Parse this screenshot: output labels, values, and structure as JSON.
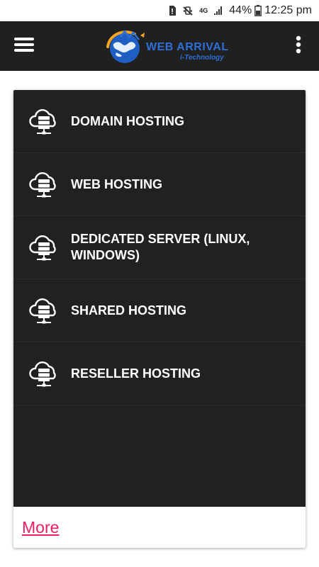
{
  "status_bar": {
    "network_label": "4G",
    "battery": "44%",
    "time": "12:25 pm",
    "icons": [
      "sim-alert-icon",
      "vibrate-off-icon",
      "network-4g-icon",
      "signal-icon",
      "battery-icon"
    ]
  },
  "app_bar": {
    "menu_icon": "hamburger-menu-icon",
    "overflow_icon": "overflow-menu-icon",
    "logo": {
      "title": "WEB ARRIVAL",
      "subtitle": "i-Technology"
    }
  },
  "services": {
    "items": [
      {
        "label": "DOMAIN HOSTING",
        "icon": "cloud-server-icon"
      },
      {
        "label": "WEB HOSTING",
        "icon": "cloud-server-icon"
      },
      {
        "label": "DEDICATED SERVER (LINUX, WINDOWS)",
        "icon": "cloud-server-icon"
      },
      {
        "label": "SHARED HOSTING",
        "icon": "cloud-server-icon"
      },
      {
        "label": "RESELLER HOSTING",
        "icon": "cloud-server-icon"
      }
    ],
    "more_label": "More"
  },
  "colors": {
    "app_bar_bg": "#202020",
    "card_bg": "#212121",
    "link": "#e91e63",
    "logo_blue": "#2d6fd6"
  }
}
